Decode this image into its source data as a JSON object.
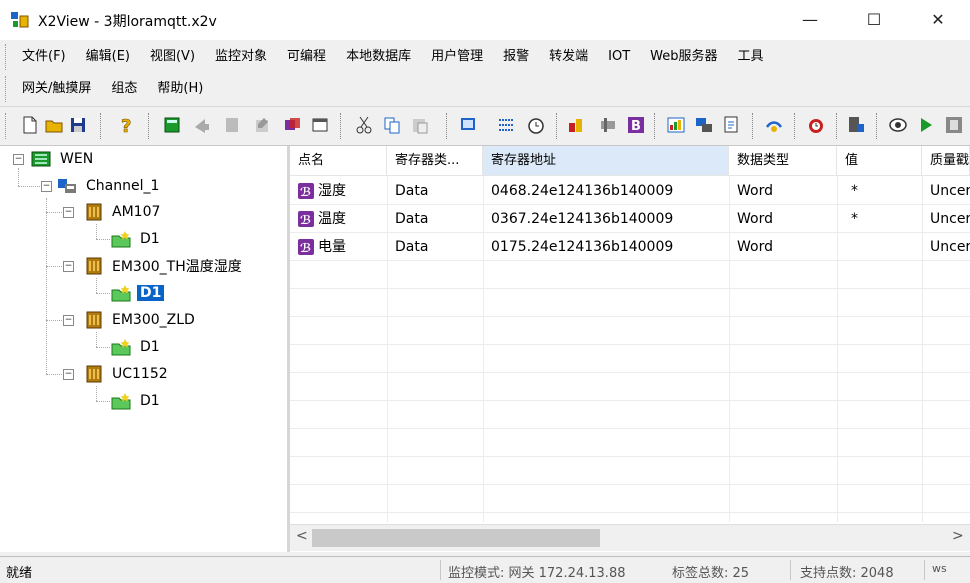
{
  "window": {
    "title": "X2View - 3期loramqtt.x2v",
    "minimize": "—",
    "maximize": "☐",
    "close": "✕"
  },
  "menu": {
    "row1": [
      "文件(F)",
      "编辑(E)",
      "视图(V)",
      "监控对象",
      "可编程",
      "本地数据库",
      "用户管理",
      "报警",
      "转发端",
      "IOT",
      "Web服务器",
      "工具"
    ],
    "row2": [
      "网关/触摸屏",
      "组态",
      "帮助(H)"
    ]
  },
  "toolbar": {
    "icons": [
      "new-file-icon",
      "open-folder-icon",
      "save-icon",
      "help-icon",
      "device-icon",
      "arrow-icon",
      "page-icon",
      "edit-icon",
      "cube-icon",
      "window-icon",
      "cut-icon",
      "copy-icon",
      "paste-icon",
      "monitor-icon",
      "list-icon",
      "clock-icon",
      "tools-icon",
      "settings-icon",
      "bold-b-icon",
      "chart-icon",
      "network-icon",
      "report-icon",
      "plug-icon",
      "alarm-icon",
      "server-icon",
      "eye-icon",
      "play-icon",
      "stop-icon"
    ],
    "colors": {
      "blue": "#1e64c8",
      "purple": "#7b2f9e",
      "green": "#1a9a2a",
      "red": "#c82020",
      "yellow": "#e6b400",
      "gray": "#707070"
    }
  },
  "tree": {
    "root": "WEN",
    "channel": "Channel_1",
    "devices": [
      {
        "name": "AM107",
        "child": "D1"
      },
      {
        "name": "EM300_TH温度湿度",
        "child": "D1"
      },
      {
        "name": "EM300_ZLD",
        "child": "D1"
      },
      {
        "name": "UC1152",
        "child": "D1"
      }
    ],
    "selected_device_index": 1
  },
  "list": {
    "columns": [
      "点名",
      "寄存器类...",
      "寄存器地址",
      "数据类型",
      "值",
      "质量戳"
    ],
    "rows": [
      {
        "name": "湿度",
        "reg_type": "Data",
        "address": "0468.24e124136b140009",
        "data_type": "Word",
        "value": "*",
        "quality": "Uncert"
      },
      {
        "name": "温度",
        "reg_type": "Data",
        "address": "0367.24e124136b140009",
        "data_type": "Word",
        "value": "*",
        "quality": "Uncert"
      },
      {
        "name": "电量",
        "reg_type": "Data",
        "address": "0175.24e124136b140009",
        "data_type": "Word",
        "value": "",
        "quality": "Uncert"
      }
    ],
    "scroll_left": "<",
    "scroll_right": ">"
  },
  "status": {
    "ready": "就绪",
    "monitor_mode": "监控模式: 网关 172.24.13.88",
    "tag_total": "标签总数: 25",
    "supported_points": "支持点数: 2048",
    "extra": "ws"
  }
}
